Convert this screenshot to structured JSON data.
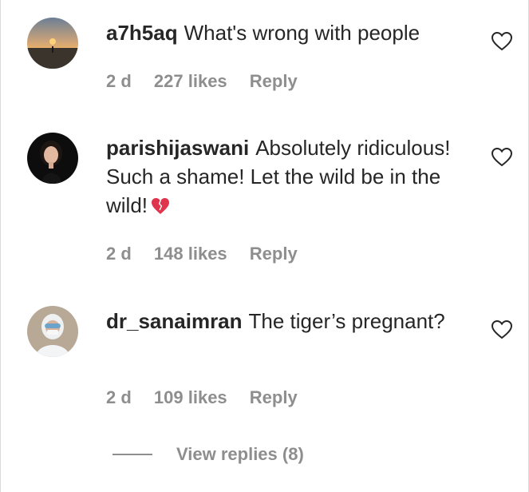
{
  "comments": [
    {
      "username": "a7h5aq",
      "text": "What's wrong with people",
      "time": "2 d",
      "likes": "227 likes",
      "reply_label": "Reply",
      "avatar_icon": "sunset-beach-avatar"
    },
    {
      "username": "parishijaswani",
      "text": "Absolutely ridiculous! Such a shame! Let the wild be in the wild!",
      "emoji": "broken-heart-emoji",
      "time": "2 d",
      "likes": "148 likes",
      "reply_label": "Reply",
      "avatar_icon": "portrait-avatar"
    },
    {
      "username": "dr_sanaimran",
      "text": "The tiger’s pregnant?",
      "time": "2 d",
      "likes": "109 likes",
      "reply_label": "Reply",
      "avatar_icon": "ppe-suit-avatar"
    }
  ],
  "view_replies": {
    "label": "View replies (8)"
  },
  "colors": {
    "text": "#262626",
    "secondary": "#8e8e8e",
    "border": "#dbdbdb",
    "broken_heart": "#e0334c"
  }
}
